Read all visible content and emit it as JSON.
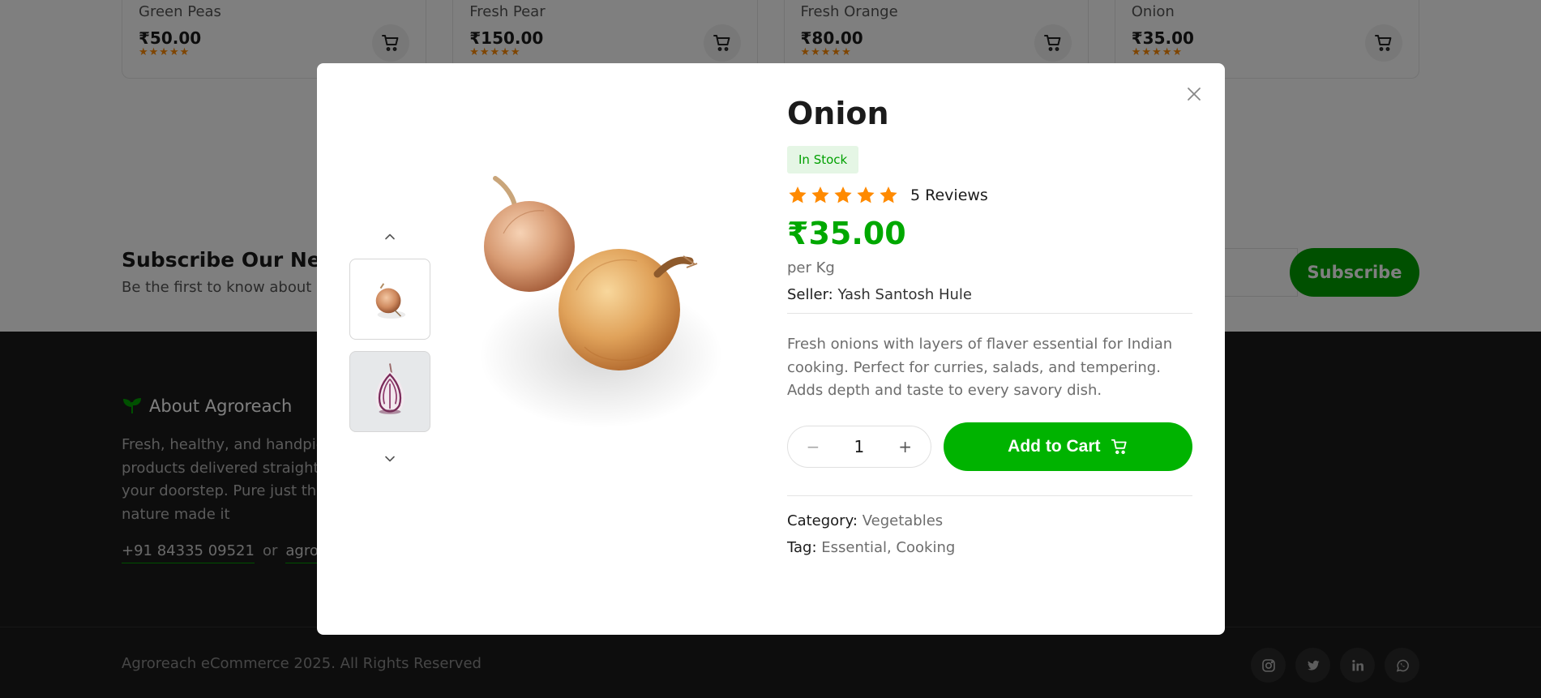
{
  "background": {
    "products": [
      {
        "name": "Green Peas",
        "price": "₹50.00",
        "rating": 5
      },
      {
        "name": "Fresh Pear",
        "price": "₹150.00",
        "rating": 5
      },
      {
        "name": "Fresh Orange",
        "price": "₹80.00",
        "rating": 5
      },
      {
        "name": "Onion",
        "price": "₹35.00",
        "rating": 5
      }
    ],
    "subscribe": {
      "title": "Subscribe Our New",
      "subtitle": "Be the first to know about o",
      "button": "Subscribe"
    },
    "footer": {
      "about_title": "About Agroreach",
      "about_text": "Fresh, healthy, and handpic products delivered straight farms to your doorstep. Pure just the way nature made it",
      "phone": "+91 84335 09521",
      "or": "or",
      "email": "agroreac",
      "copyright": "Agroreach eCommerce 2025. All Rights Reserved",
      "socials": [
        "instagram-icon",
        "twitter-icon",
        "linkedin-icon",
        "whatsapp-icon"
      ]
    }
  },
  "modal": {
    "title": "Onion",
    "stock": "In Stock",
    "rating": 5,
    "reviews": "5 Reviews",
    "price": "₹35.00",
    "unit": "per Kg",
    "seller_label": "Seller:",
    "seller_name": "Yash Santosh Hule",
    "description": "Fresh onions with layers of flaver essential for Indian cooking. Perfect for curries, salads, and tempering. Adds depth and taste to every savory dish.",
    "quantity": "1",
    "qty_minus": "−",
    "qty_plus": "+",
    "add_to_cart": "Add to Cart",
    "category_label": "Category:",
    "category": "Vegetables",
    "tag_label": "Tag:",
    "tags": "Essential, Cooking"
  },
  "colors": {
    "brand_green": "#00b300",
    "star_orange": "#ff8a00",
    "footer_bg": "#1b1b1b"
  }
}
